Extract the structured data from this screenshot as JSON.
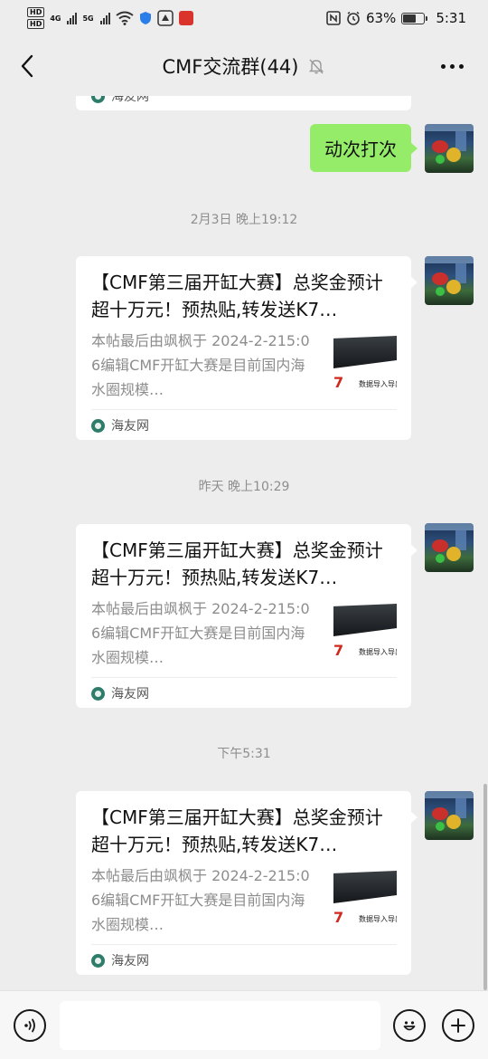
{
  "status_bar": {
    "hd1": "HD",
    "hd2": "HD",
    "net1": "4G",
    "net2": "5G",
    "battery_percent": "63%",
    "time": "5:31"
  },
  "header": {
    "title": "CMF交流群(44)"
  },
  "messages": {
    "partial_source": "海友网",
    "sent_text": "动次打次",
    "ts1": "2月3日 晚上19:12",
    "ts2": "昨天 晚上10:29",
    "ts3": "下午5:31",
    "cards": [
      {
        "title": "【CMF第三届开缸大赛】总奖金预计超十万元！预热贴,转发送K7…",
        "desc": "本帖最后由飒枫于 2024-2-215:06编辑CMF开缸大赛是目前国内海水圈规模…",
        "source": "海友网"
      },
      {
        "title": "【CMF第三届开缸大赛】总奖金预计超十万元！预热贴,转发送K7…",
        "desc": "本帖最后由飒枫于 2024-2-215:06编辑CMF开缸大赛是目前国内海水圈规模…",
        "source": "海友网"
      },
      {
        "title": "【CMF第三届开缸大赛】总奖金预计超十万元！预热贴,转发送K7…",
        "desc": "本帖最后由飒枫于 2024-2-215:06编辑CMF开缸大赛是目前国内海水圈规模…",
        "source": "海友网"
      }
    ],
    "thumb_text": "数据导入导出",
    "thumb_digit": "7"
  },
  "input_bar": {
    "text_value": ""
  },
  "colors": {
    "chat_bg": "#ededed",
    "sent_bubble": "#95ec69",
    "timestamp": "#8e8e8e"
  },
  "icons": {
    "back": "chevron-left-icon",
    "more": "more-dots-icon",
    "mute": "bell-off-icon",
    "voice": "voice-icon",
    "emoji": "emoji-icon",
    "plus": "plus-icon"
  }
}
